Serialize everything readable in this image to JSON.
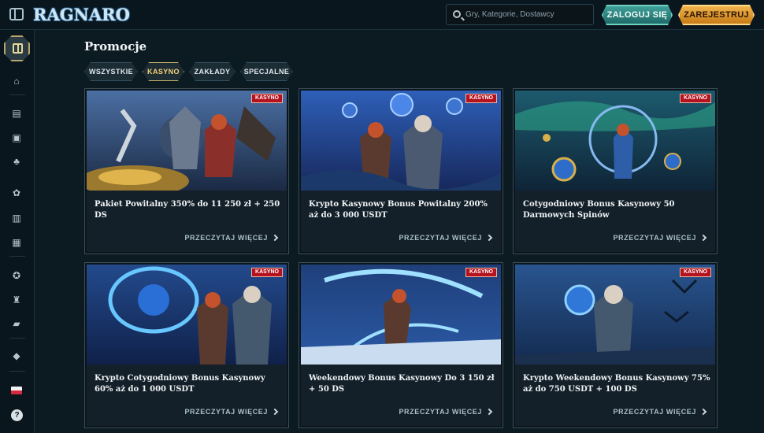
{
  "header": {
    "logo_text": "RAGNARO",
    "search_placeholder": "Gry, Kategorie, Dostawcy",
    "login_label": "ZALOGUJ SIĘ",
    "register_label": "ZAREJESTRUJ"
  },
  "sidebar": {
    "icons": [
      "gift-icon",
      "home-icon",
      "slot-machine-icon",
      "cards-icon",
      "clover-icon",
      "chip-icon",
      "live-icon",
      "sports-icon",
      "medal-icon",
      "trophy-icon",
      "briefcase-icon",
      "diamond-icon",
      "poland-flag-icon",
      "help-icon"
    ],
    "help_label": "?"
  },
  "main": {
    "title": "Promocje",
    "filters": [
      {
        "label": "WSZYSTKIE",
        "active": false
      },
      {
        "label": "KASYNO",
        "active": true
      },
      {
        "label": "ZAKŁADY",
        "active": false
      },
      {
        "label": "SPECJALNE",
        "active": false
      }
    ],
    "cards": [
      {
        "badge": "KASYNO",
        "title": "Pakiet Powitalny 350% do 11 250 zł + 250 DS",
        "link": "PRZECZYTAJ WIĘCEJ"
      },
      {
        "badge": "KASYNO",
        "title": "Krypto Kasynowy Bonus Powitalny 200% aż do 3 000 USDT",
        "link": "PRZECZYTAJ WIĘCEJ"
      },
      {
        "badge": "KASYNO",
        "title": "Cotygodniowy Bonus Kasynowy 50 Darmowych Spinów",
        "link": "PRZECZYTAJ WIĘCEJ"
      },
      {
        "badge": "KASYNO",
        "title": "Krypto Cotygodniowy Bonus Kasynowy 60% aż do 1 000 USDT",
        "link": "PRZECZYTAJ WIĘCEJ"
      },
      {
        "badge": "KASYNO",
        "title": "Weekendowy Bonus Kasynowy Do 3 150 zł + 50 DS",
        "link": "PRZECZYTAJ WIĘCEJ"
      },
      {
        "badge": "KASYNO",
        "title": "Krypto Weekendowy Bonus Kasynowy 75% aż do 750 USDT + 100 DS",
        "link": "PRZECZYTAJ WIĘCEJ"
      }
    ]
  },
  "colors": {
    "background": "#0c1a22",
    "login_button": "#2f8a84",
    "register_button": "#e39a2d",
    "active_filter_text": "#f5d27a",
    "badge": "#b3121e"
  }
}
